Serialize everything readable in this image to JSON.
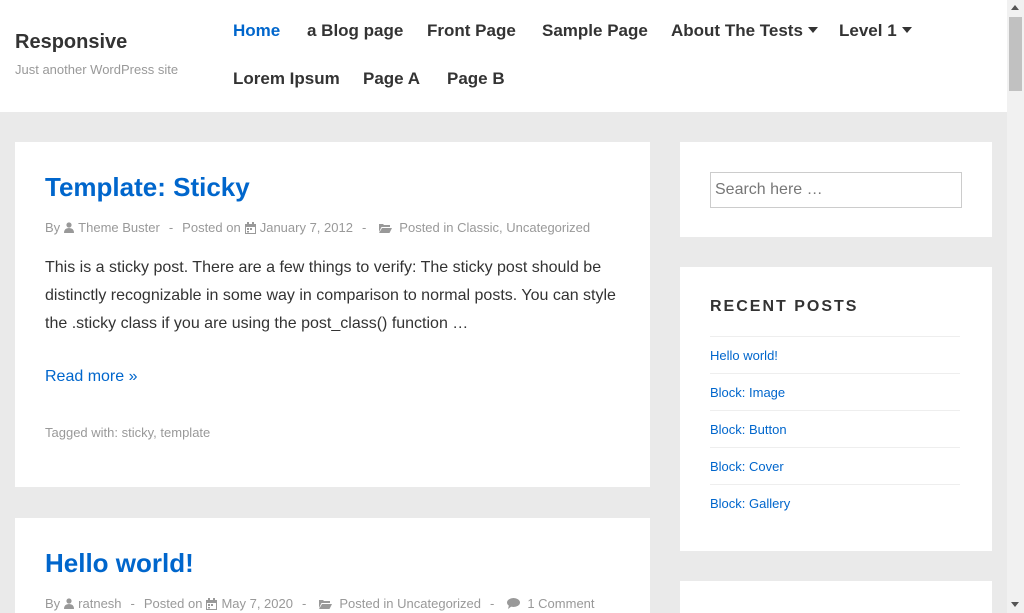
{
  "header": {
    "site_title": "Responsive",
    "tagline": "Just another WordPress site",
    "nav": [
      {
        "label": "Home",
        "active": true,
        "dropdown": false
      },
      {
        "label": "a Blog page",
        "dropdown": false
      },
      {
        "label": "Front Page",
        "dropdown": false
      },
      {
        "label": "Sample Page",
        "dropdown": false
      },
      {
        "label": "About The Tests",
        "dropdown": true
      },
      {
        "label": "Level 1",
        "dropdown": true
      },
      {
        "label": "Lorem Ipsum",
        "dropdown": false
      },
      {
        "label": "Page A",
        "dropdown": false
      },
      {
        "label": "Page B",
        "dropdown": false
      }
    ]
  },
  "posts": [
    {
      "title": "Template: Sticky",
      "by": "By",
      "author": "Theme Buster",
      "posted_on": "Posted on",
      "date": "January 7, 2012",
      "posted_in": "Posted in",
      "cat1": "Classic",
      "cat2": "Uncategorized",
      "excerpt": "This is a sticky post. There are a few things to verify: The sticky post should be distinctly recognizable in some way in comparison to normal posts. You can style the .sticky class if you are using the post_class() function …",
      "read_more": "Read more »",
      "tagged_with": "Tagged with:",
      "tag1": "sticky",
      "tag2": "template"
    },
    {
      "title": "Hello world!",
      "by": "By",
      "author": "ratnesh",
      "posted_on": "Posted on",
      "date": "May 7, 2020",
      "posted_in": "Posted in",
      "cat1": "Uncategorized",
      "comments": "1 Comment"
    }
  ],
  "sidebar": {
    "search_placeholder": "Search here …",
    "recent_title": "RECENT POSTS",
    "recent_posts": [
      "Hello world!",
      "Block: Image",
      "Block: Button",
      "Block: Cover",
      "Block: Gallery"
    ]
  },
  "colors": {
    "link": "#0066cc",
    "background": "#eaeaea",
    "meta": "#999999"
  },
  "icons": [
    "user-icon",
    "calendar-icon",
    "folder-icon",
    "comment-icon",
    "caret-down-icon"
  ]
}
